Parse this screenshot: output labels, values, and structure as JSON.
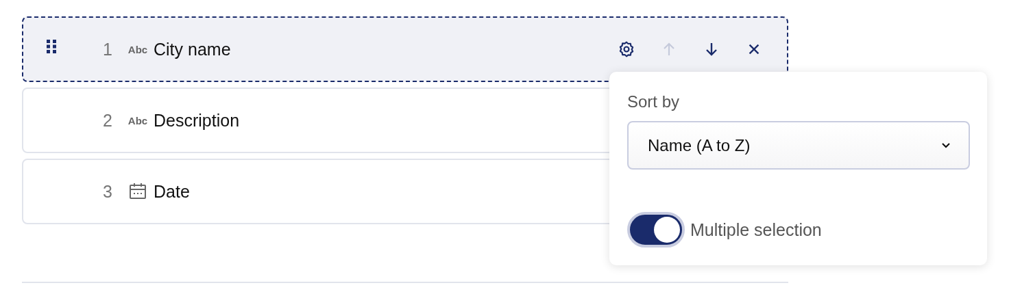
{
  "fields": [
    {
      "number": "1",
      "kind": "text",
      "type_label": "Abc",
      "name": "City name",
      "selected": true
    },
    {
      "number": "2",
      "kind": "text",
      "type_label": "Abc",
      "name": "Description",
      "selected": false
    },
    {
      "number": "3",
      "kind": "date",
      "name": "Date",
      "selected": false
    }
  ],
  "row_actions": [
    {
      "kind": "settings",
      "disabled": false
    },
    {
      "kind": "up",
      "disabled": true
    },
    {
      "kind": "down",
      "disabled": false
    },
    {
      "kind": "remove",
      "disabled": false
    }
  ],
  "popover": {
    "sort_label": "Sort by",
    "sort_value": "Name (A to Z)",
    "multiple": {
      "label": "Multiple selection",
      "on": true
    }
  }
}
